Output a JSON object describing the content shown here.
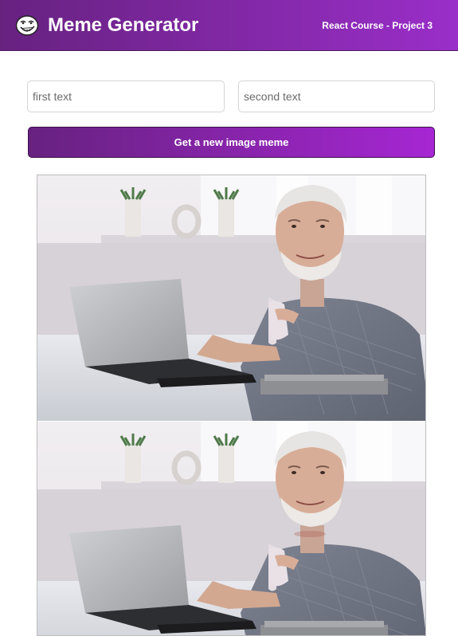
{
  "header": {
    "title": "Meme Generator",
    "subtitle": "React Course - Project 3",
    "logo_icon": "troll-face-icon"
  },
  "form": {
    "top_text_placeholder": "first text",
    "top_text_value": "",
    "bottom_text_placeholder": "second text",
    "bottom_text_value": "",
    "submit_label": "Get a new image meme"
  },
  "meme": {
    "image_name": "hide-the-pain-harold-meme-image",
    "panels": 2
  },
  "colors": {
    "gradient_start": "#672280",
    "gradient_end": "#a626d3",
    "background": "#ffffff"
  }
}
